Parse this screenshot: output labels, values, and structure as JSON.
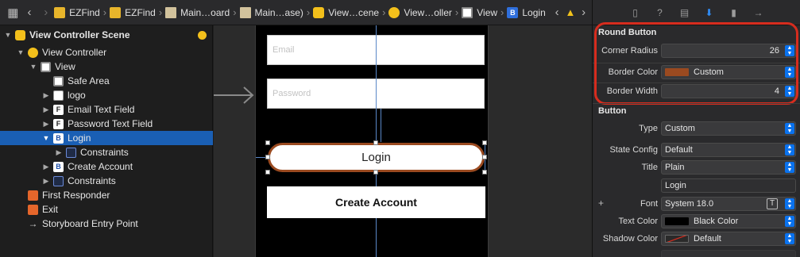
{
  "jumpbar": {
    "items": [
      {
        "label": "EZFind",
        "icon": "folder-icon"
      },
      {
        "label": "EZFind",
        "icon": "folder-icon"
      },
      {
        "label": "Main…oard",
        "icon": "storyboard-file-icon"
      },
      {
        "label": "Main…ase)",
        "icon": "storyboard-file-icon"
      },
      {
        "label": "View…cene",
        "icon": "scene-icon"
      },
      {
        "label": "View…oller",
        "icon": "view-controller-icon"
      },
      {
        "label": "View",
        "icon": "view-icon"
      },
      {
        "label": "Login",
        "icon": "button-b-icon"
      }
    ]
  },
  "outline": {
    "rows": [
      {
        "label": "View Controller Scene",
        "icon": "scene-icon"
      },
      {
        "label": "View Controller",
        "icon": "view-controller-icon"
      },
      {
        "label": "View",
        "icon": "view-icon"
      },
      {
        "label": "Safe Area",
        "icon": "safe-area-icon"
      },
      {
        "label": "logo",
        "icon": "image-view-icon"
      },
      {
        "label": "Email Text Field",
        "icon": "text-field-icon",
        "glyph": "F"
      },
      {
        "label": "Password Text Field",
        "icon": "text-field-icon",
        "glyph": "F"
      },
      {
        "label": "Login",
        "icon": "button-icon",
        "glyph": "B",
        "selected": true
      },
      {
        "label": "Constraints",
        "icon": "constraints-icon"
      },
      {
        "label": "Create Account",
        "icon": "button-icon",
        "glyph": "B"
      },
      {
        "label": "Constraints",
        "icon": "constraints-icon"
      },
      {
        "label": "First Responder",
        "icon": "first-responder-icon"
      },
      {
        "label": "Exit",
        "icon": "exit-icon"
      },
      {
        "label": "Storyboard Entry Point",
        "icon": "entry-arrow-icon"
      }
    ]
  },
  "canvas": {
    "email_placeholder": "Email",
    "password_placeholder": "Password",
    "login_label": "Login",
    "create_account_label": "Create Account"
  },
  "inspector": {
    "round_button": {
      "title": "Round Button",
      "corner_radius_label": "Corner Radius",
      "corner_radius_value": "26",
      "border_color_label": "Border Color",
      "border_color_value": "Custom",
      "border_color_swatch": "#9a4a20",
      "border_width_label": "Border Width",
      "border_width_value": "4"
    },
    "button": {
      "title": "Button",
      "type_label": "Type",
      "type_value": "Custom",
      "state_config_label": "State Config",
      "state_config_value": "Default",
      "title_label": "Title",
      "title_value": "Plain",
      "title_text": "Login",
      "font_label": "Font",
      "font_value": "System 18.0",
      "text_color_label": "Text Color",
      "text_color_value": "Black Color",
      "text_color_swatch": "#000000",
      "shadow_color_label": "Shadow Color",
      "shadow_color_value": "Default"
    }
  },
  "colors": {
    "selection": "#1a5fb4",
    "accent": "#0a72ee",
    "highlight_ring": "#d62c1e"
  }
}
